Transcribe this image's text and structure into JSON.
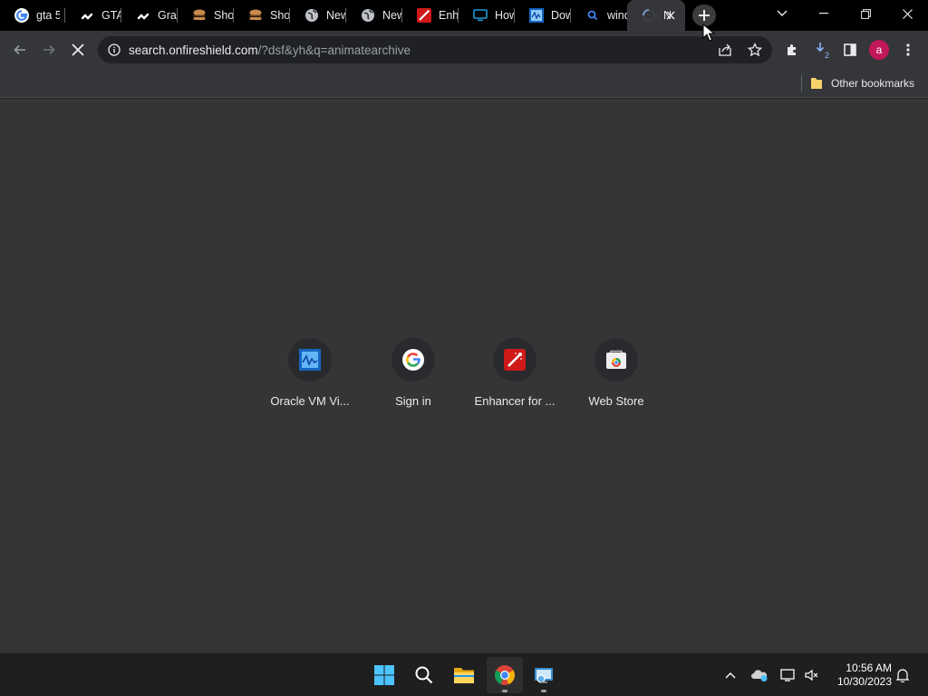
{
  "tabs": [
    {
      "title": "gta 5",
      "icon": "google-icon"
    },
    {
      "title": "GTA",
      "icon": "link-icon"
    },
    {
      "title": "Grand",
      "icon": "link-icon"
    },
    {
      "title": "Shop",
      "icon": "burger-icon"
    },
    {
      "title": "Shop",
      "icon": "burger-icon"
    },
    {
      "title": "New",
      "icon": "globe-icon"
    },
    {
      "title": "New",
      "icon": "globe-icon"
    },
    {
      "title": "Enh",
      "icon": "enhancer-icon"
    },
    {
      "title": "How",
      "icon": "monitor-icon"
    },
    {
      "title": "Dow",
      "icon": "virtualbox-icon"
    },
    {
      "title": "wind",
      "icon": "search-icon"
    },
    {
      "title": "N",
      "icon": "loading-icon",
      "active": true
    }
  ],
  "address": {
    "host": "search.onfireshield.com",
    "path": "/?dsf&yh&q=animatearchive"
  },
  "bookmarks": {
    "other_label": "Other bookmarks"
  },
  "profile": {
    "initial": "a",
    "color": "#c2185b"
  },
  "downloads_badge": "2",
  "shortcuts": [
    {
      "label": "Oracle VM Vi...",
      "icon": "virtualbox-icon"
    },
    {
      "label": "Sign in",
      "icon": "google-icon"
    },
    {
      "label": "Enhancer for ...",
      "icon": "enhancer-icon"
    },
    {
      "label": "Web Store",
      "icon": "webstore-icon"
    }
  ],
  "clock": {
    "time": "10:56 AM",
    "date": "10/30/2023"
  },
  "colors": {
    "page_bg": "#353535",
    "toolbar_bg": "#35363a",
    "tabstrip_bg": "#000000"
  }
}
